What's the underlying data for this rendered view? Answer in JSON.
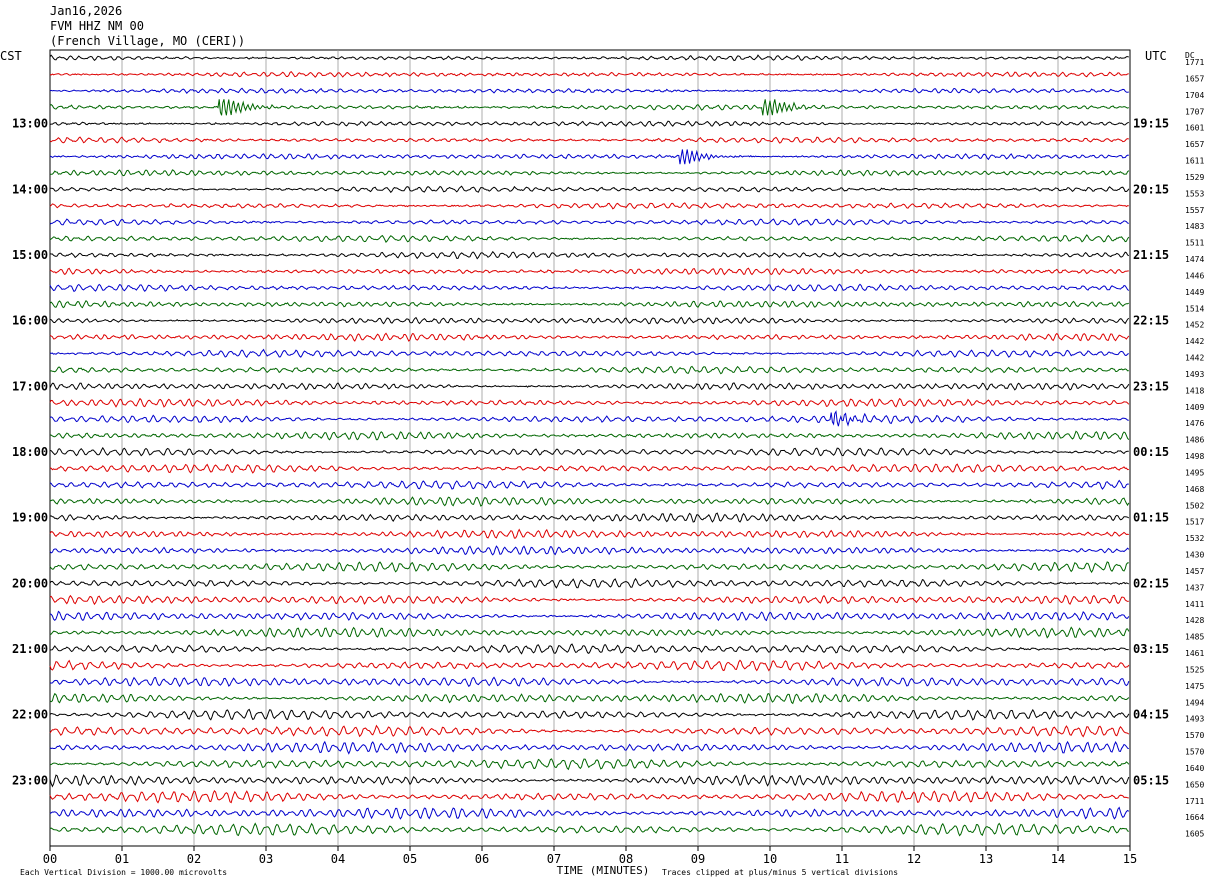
{
  "header": {
    "date": "Jan16,2026",
    "station": "FVM HHZ NM 00",
    "location": "(French Village, MO (CERI))"
  },
  "chart_data": {
    "type": "line",
    "title": "Jan16,2026",
    "left_timezone": "CST",
    "right_timezone": "UTC",
    "right_top_label": "DC",
    "xlabel": "TIME (MINUTES)",
    "x_ticks": [
      "00",
      "01",
      "02",
      "03",
      "04",
      "05",
      "06",
      "07",
      "08",
      "09",
      "10",
      "11",
      "12",
      "13",
      "14",
      "15"
    ],
    "xlim": [
      0,
      15
    ],
    "grid": true,
    "trace_colors": [
      "#000000",
      "#dd0000",
      "#0000cc",
      "#006600"
    ],
    "left_hour_labels": [
      "13:00",
      "14:00",
      "15:00",
      "16:00",
      "17:00",
      "18:00",
      "19:00",
      "20:00",
      "21:00",
      "22:00",
      "23:00"
    ],
    "right_hour_labels": [
      "19:15",
      "20:15",
      "21:15",
      "22:15",
      "23:15",
      "00:15",
      "01:15",
      "02:15",
      "03:15",
      "04:15",
      "05:15"
    ],
    "dc_offsets": [
      1771,
      1657,
      1704,
      1707,
      1601,
      1657,
      1611,
      1529,
      1553,
      1557,
      1483,
      1511,
      1474,
      1446,
      1449,
      1514,
      1452,
      1442,
      1442,
      1493,
      1418,
      1409,
      1476,
      1486,
      1498,
      1495,
      1468,
      1502,
      1517,
      1532,
      1430,
      1457,
      1437,
      1411,
      1428,
      1485,
      1461,
      1525,
      1475,
      1494,
      1493,
      1570,
      1570,
      1640,
      1650,
      1711,
      1664,
      1605
    ],
    "events": [
      {
        "trace": 3,
        "minute": 2.4,
        "amplitude": 1.0
      },
      {
        "trace": 3,
        "minute": 9.95,
        "amplitude": 0.9
      },
      {
        "trace": 6,
        "minute": 8.8,
        "amplitude": 0.7
      },
      {
        "trace": 22,
        "minute": 10.9,
        "amplitude": 0.6
      }
    ],
    "footer_left": "Each Vertical Division = 1000.00 microvolts",
    "footer_right": "Traces clipped at plus/minus 5 vertical divisions"
  }
}
